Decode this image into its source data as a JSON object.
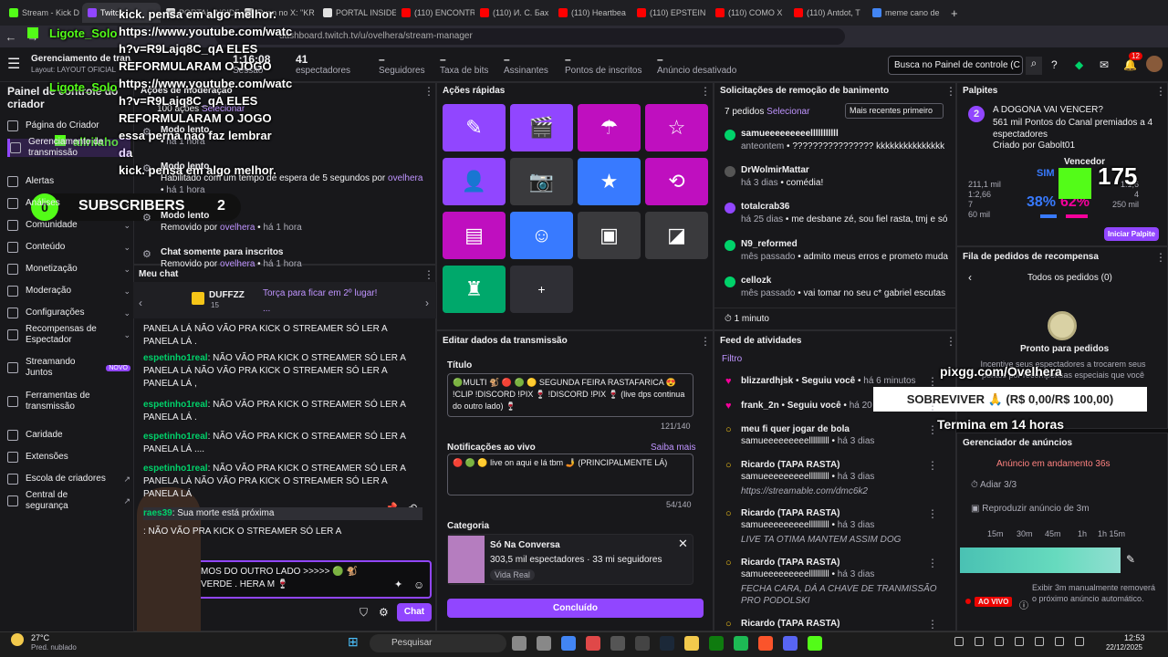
{
  "browser": {
    "tabs": [
      {
        "label": "Stream - Kick D",
        "color": "#53fc18"
      },
      {
        "label": "Twitch",
        "color": "#9146ff"
      },
      {
        "label": "PORTAL INSIDE",
        "color": "#e1e1e1"
      },
      {
        "label": "Ryan no X: \"KR",
        "color": "#e1e1e1"
      },
      {
        "label": "PORTAL INSIDE",
        "color": "#e1e1e1"
      },
      {
        "label": "(110) ENCONTR",
        "color": "#ff0000"
      },
      {
        "label": "(110) И. С. Бах",
        "color": "#ff0000"
      },
      {
        "label": "(110) Heartbea",
        "color": "#ff0000"
      },
      {
        "label": "(110) EPSTEIN",
        "color": "#ff0000"
      },
      {
        "label": "(110) COMO X",
        "color": "#ff0000"
      },
      {
        "label": "(110) Antdot, T",
        "color": "#ff0000"
      },
      {
        "label": "meme cano de",
        "color": "#4285f4"
      }
    ],
    "new_tab": "+",
    "url": "dashboard.twitch.tv/u/ovelhera/stream-manager"
  },
  "dashboard": {
    "title": "Gerenciamento de tran...",
    "layout": "Layout: LAYOUT OFICIAL",
    "stats": [
      {
        "value": "1:16:08",
        "label": "Sessão"
      },
      {
        "value": "41",
        "label": "espectadores"
      },
      {
        "value": "–",
        "label": "Seguidores"
      },
      {
        "value": "–",
        "label": "Taxa de bits"
      },
      {
        "value": "–",
        "label": "Assinantes"
      },
      {
        "value": "–",
        "label": "Pontos de inscritos"
      },
      {
        "value": "–",
        "label": "Anúncio desativado"
      }
    ],
    "search_placeholder": "Busca no Painel de controle (C",
    "notif_count": "12"
  },
  "sidebar": {
    "title": "Painel de controle do criador",
    "items": [
      {
        "label": "Página do Criador",
        "chev": ""
      },
      {
        "label": "Gerenciamento de transmissão",
        "chev": ""
      },
      {
        "label": "Alertas",
        "chev": ""
      },
      {
        "label": "Análises",
        "chev": "⌄"
      },
      {
        "label": "Comunidade",
        "chev": "⌄"
      },
      {
        "label": "Conteúdo",
        "chev": "⌄"
      },
      {
        "label": "Monetização",
        "chev": "⌄"
      },
      {
        "label": "Moderação",
        "chev": "⌄"
      },
      {
        "label": "Configurações",
        "chev": "⌄"
      },
      {
        "label": "Recompensas de Espectador",
        "chev": "⌄"
      },
      {
        "label": "Streamando Juntos",
        "chev": "NOVO"
      },
      {
        "label": "Ferramentas de transmissão",
        "chev": ""
      },
      {
        "label": "Caridade",
        "chev": ""
      },
      {
        "label": "Extensões",
        "chev": ""
      },
      {
        "label": "Escola de criadores",
        "chev": "↗"
      },
      {
        "label": "Central de segurança",
        "chev": "↗"
      }
    ]
  },
  "mod": {
    "header": "Ações de moderação",
    "count": "100 ações",
    "select": "Selecionar",
    "entries": [
      {
        "title": "Modo lento",
        "desc": "",
        "time": "há 1 hora"
      },
      {
        "title": "Modo lento",
        "desc": "Habilitado com um tempo de espera de 5 segundos por",
        "who": "ovelhera",
        "time": "há 1 hora"
      },
      {
        "title": "Modo lento",
        "desc": "Removido por",
        "who": "ovelhera",
        "time": "há 1 hora"
      },
      {
        "title": "Chat somente para inscritos",
        "desc": "Removido por",
        "who": "ovelhera",
        "time": "há 1 hora"
      }
    ]
  },
  "chat": {
    "header": "Meu chat",
    "pinned_user": "DUFFZZ",
    "pinned_badge": "15",
    "pinned_text": "Torça para ficar em 2º lugar!",
    "pinned_more": "...",
    "lines": [
      {
        "user": "",
        "text": "PANELA LÁ NÃO VÃO PRA KICK O STREAMER SÓ LER A PANELA LÁ ."
      },
      {
        "user": "espetinho1real",
        "text": ": NÃO VÃO PRA KICK O STREAMER SÓ LER A PANELA LÁ NÃO VÃO PRA KICK O STREAMER SÓ LER A PANELA LÁ ,"
      },
      {
        "user": "espetinho1real",
        "text": ": NÃO VÃO PRA KICK O STREAMER SÓ LER A PANELA LÁ ."
      },
      {
        "user": "espetinho1real",
        "text": ": NÃO VÃO PRA KICK O STREAMER SÓ LER A PANELA LÁ ...."
      },
      {
        "user": "espetinho1real",
        "text": ": NÃO VÃO PRA KICK O STREAMER SÓ LER A PANELA LÁ NÃO VÃO PRA KICK O STREAMER SÓ LER A PANELA LÁ"
      },
      {
        "user": "raes39",
        "text": ": Sua morte está próxima"
      },
      {
        "user": "",
        "text": ": NÃO VÃO PRA KICK O STREAMER SÓ LER A"
      }
    ],
    "input_text": "MOS DO OUTRO LADO >>>>> 🟢 🐒 VERDE . HERA M 🍷",
    "send": "Chat"
  },
  "quick": {
    "header": "Ações rápidas",
    "add": "+"
  },
  "edit": {
    "header": "Editar dados da transmissão",
    "title_label": "Título",
    "title_value": "🟢MULTI 🐒 🔴 🟢 🟡 SEGUNDA FEIRA RASTAFARICA 😍 !CLIP !DISCORD !PIX 🍷 !DISCORD !PIX 🍷 (live dps continua do outro lado) 🍷",
    "title_count": "121/140",
    "notif_label": "Notificações ao vivo",
    "notif_link": "Saiba mais",
    "notif_value": "🔴 🟢 🟡  live on aqui e lá tbm 🤳 (PRINCIPALMENTE LÁ)",
    "notif_count": "54/140",
    "cat_label": "Categoria",
    "cat_name": "Só Na Conversa",
    "cat_viewers": "303,5 mil espectadores",
    "cat_followers": "33 mi seguidores",
    "cat_tag": "Vida Real",
    "done": "Concluído"
  },
  "unban": {
    "header": "Solicitações de remoção de banimento",
    "count": "7 pedidos",
    "select": "Selecionar",
    "sort": "Mais recentes primeiro",
    "items": [
      {
        "user": "samueeeeeeeeelllllllllll",
        "time": "anteontem",
        "msg": "???????????????? kkkkkkkkkkkkkkk"
      },
      {
        "user": "DrWolmirMattar",
        "time": "há 3 dias",
        "msg": "comédia!"
      },
      {
        "user": "totalcrab36",
        "time": "há 25 dias",
        "msg": "me desbane zé, sou fiel rasta, tmj e só"
      },
      {
        "user": "N9_reformed",
        "time": "mês passado",
        "msg": "admito meus erros e prometo muda"
      },
      {
        "user": "cellozk",
        "time": "mês passado",
        "msg": "vai tomar no seu c* gabriel escutas"
      }
    ],
    "timer": "1 minuto"
  },
  "feed": {
    "header": "Feed de atividades",
    "filter": "Filtro",
    "items": [
      {
        "user": "blizzardhjsk",
        "action": "Seguiu você",
        "time": "há 6 minutos",
        "sub": ""
      },
      {
        "user": "frank_2n",
        "action": "Seguiu você",
        "time": "há 20",
        "sub": ""
      },
      {
        "user": "meu fi quer jogar de bola",
        "action": "",
        "time": "há 3 dias",
        "sub": "samueeeeeeeeellllllllll"
      },
      {
        "user": "Ricardo (TAPA RASTA)",
        "action": "",
        "time": "há 3 dias",
        "sub": "samueeeeeeeeellllllllll",
        "msg": "https://streamable.com/dmc6k2"
      },
      {
        "user": "Ricardo (TAPA RASTA)",
        "action": "",
        "time": "há 3 dias",
        "sub": "samueeeeeeeeellllllllll",
        "msg": "LIVE TA OTIMA MANTEM ASSIM DOG"
      },
      {
        "user": "Ricardo (TAPA RASTA)",
        "action": "",
        "time": "há 3 dias",
        "sub": "samueeeeeeeeellllllllll",
        "msg": "FECHA CARA, DÁ A CHAVE DE TRANMISSÃO PRO PODOLSKI"
      },
      {
        "user": "Ricardo (TAPA RASTA)",
        "action": "",
        "time": "",
        "sub": "",
        "msg": ""
      }
    ]
  },
  "pred": {
    "header": "Palpites",
    "badge": "2",
    "question": "A DOGONA VAI VENCER?",
    "points": "561 mil Pontos do Canal premiados a 4 espectadores",
    "by": "Criado por Gabolt01",
    "yes": "SIM",
    "winner": "Vencedor",
    "stats_left": [
      "211,1 mil",
      "1:2,66",
      "7",
      "60 mil"
    ],
    "pct_left": "38%",
    "pct_right": "62%",
    "stats_right": [
      "1:1,6",
      "4",
      "250 mil"
    ],
    "start": "Iniciar Palpite"
  },
  "rewards": {
    "header": "Fila de pedidos de recompensa",
    "all": "Todos os pedidos (0)",
    "ready": "Pronto para pedidos",
    "desc": "Incentive seus espectadores a trocarem seus pontos por recompensas especiais que você"
  },
  "ads": {
    "header": "Gerenciador de anúncios",
    "running": "Anúncio em andamento",
    "running_time": "36s",
    "snooze": "Adiar 3/3",
    "preroll": "Reproduzir anúncio de 3m",
    "ticks": [
      "15m",
      "30m",
      "45m",
      "1h",
      "1h 15m"
    ],
    "live": "AO VIVO",
    "manual": "Exibir 3m manualmente removerá o próximo anúncio automático."
  },
  "overlay": {
    "user": "Ligote_Solo",
    "lines": [
      "kick. pensa em algo melhor.",
      "https://www.youtube.com/watc",
      "h?v=R9Lajq8C_qA ELES",
      "REFORMULARAM O JOGO",
      "https://www.youtube.com/watc",
      "h?v=R9Lajq8C_qA ELES",
      "REFORMULARAM O JOGO",
      "essa perna nao faz lembrar da",
      "kick. pensa em algo melhor."
    ],
    "subs_count": "0",
    "subs_label": "SUBSCRIBERS",
    "subs_goal": "2",
    "pix": "pixgg.com/Ovelhera",
    "goal": "SOBREVIVER 🙏 (R$ 0,00/R$ 100,00)",
    "ends": "Termina em 14 horas",
    "kick_num": "175",
    "follower": "allriiaho"
  },
  "taskbar": {
    "temp": "27°C",
    "weather": "Pred. nublado",
    "search": "Pesquisar",
    "time": "12:53",
    "date": "22/12/2025"
  }
}
